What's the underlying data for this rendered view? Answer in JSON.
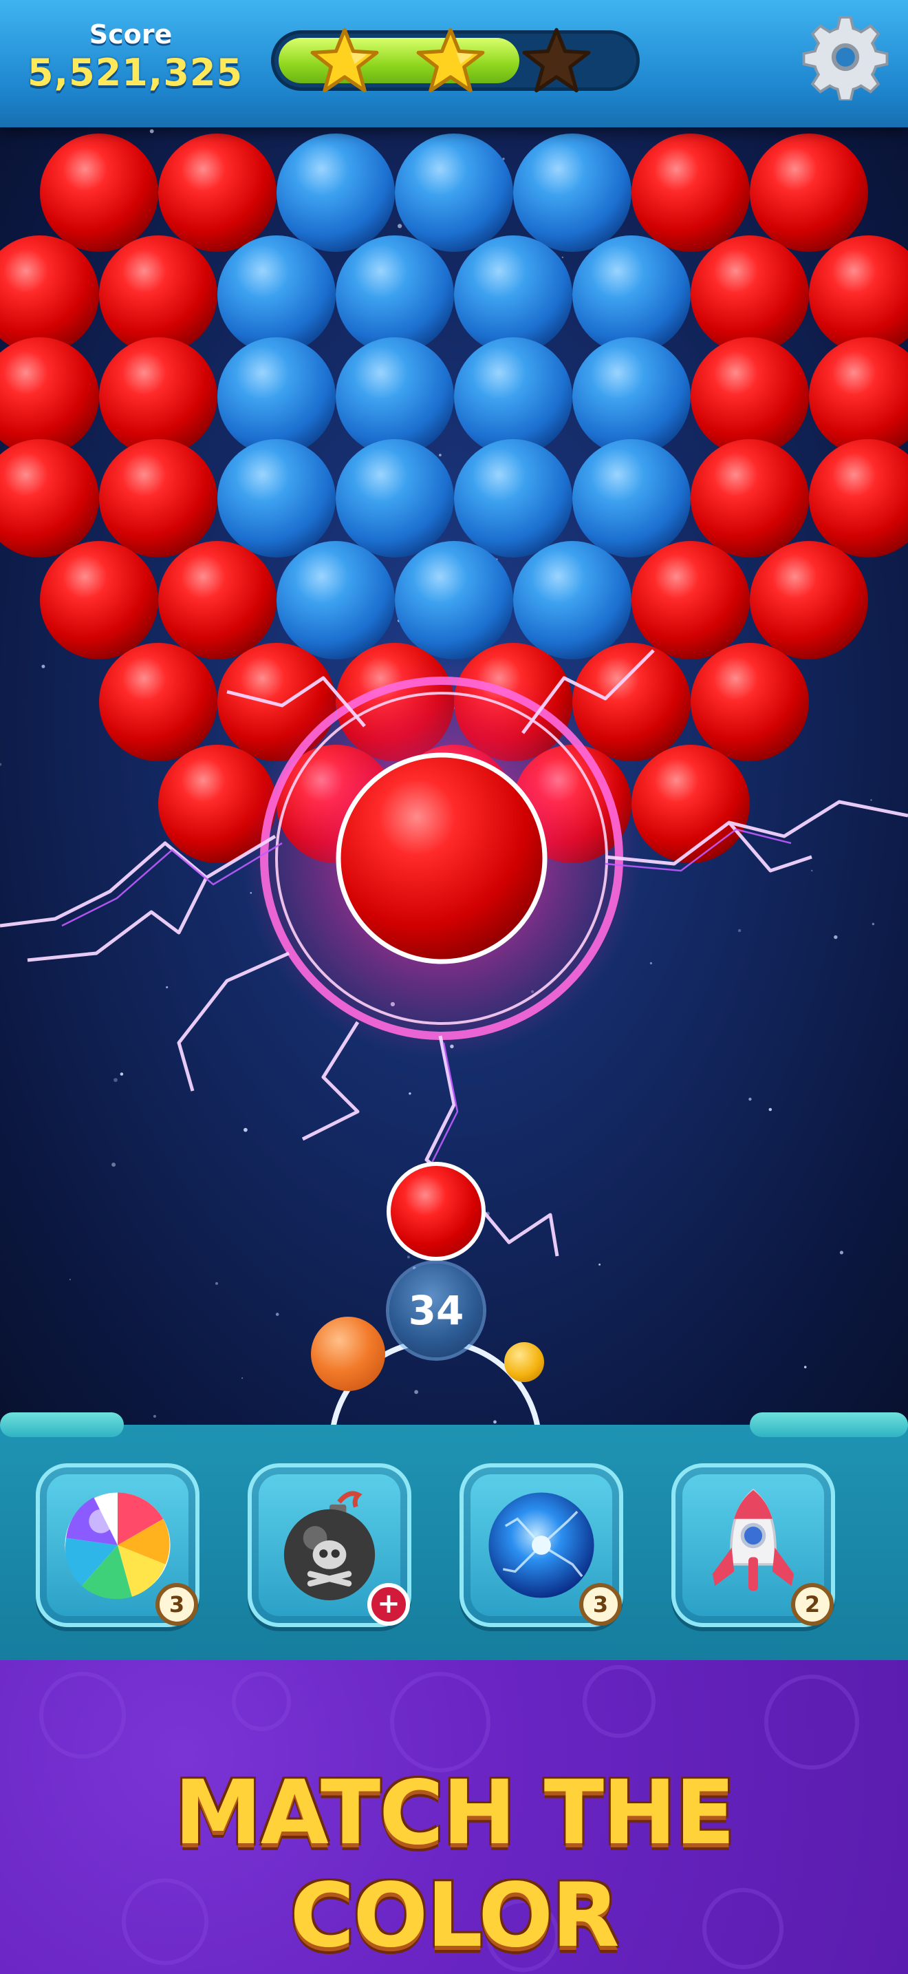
{
  "hud": {
    "score_label": "Score",
    "score_value": "5,521,325",
    "progress_fraction": 0.68,
    "stars": [
      {
        "name": "star-1",
        "earned": true
      },
      {
        "name": "star-2",
        "earned": true
      },
      {
        "name": "star-3",
        "earned": false
      }
    ],
    "settings_icon": "gear-icon"
  },
  "colors": {
    "red_bubble": "#e80f0f",
    "blue_bubble": "#2f8fe0",
    "star_gold": "#ffd21f",
    "lightning": "#ff5cf0",
    "banner_purple": "#6a25c4",
    "banner_text": "#ffd23a"
  },
  "board": {
    "rows": [
      [
        "red",
        "red",
        "blue",
        "blue",
        "blue",
        "red",
        "red"
      ],
      [
        "red",
        "red",
        "blue",
        "blue",
        "blue",
        "blue",
        "red",
        "red"
      ],
      [
        "red",
        "red",
        "blue",
        "blue",
        "blue",
        "blue",
        "red",
        "red"
      ],
      [
        "red",
        "red",
        "blue",
        "blue",
        "blue",
        "blue",
        "red",
        "red"
      ],
      [
        "red",
        "red",
        "blue",
        "blue",
        "blue",
        "red",
        "red"
      ],
      [
        "red",
        "red",
        "red",
        "red",
        "red",
        "red"
      ],
      [
        "red",
        "red",
        "red",
        "red",
        "red"
      ]
    ],
    "effect": "lightning-burst"
  },
  "shooter": {
    "current_color": "red",
    "shots_left": "34",
    "next_color": "orange"
  },
  "boosters": [
    {
      "name": "rainbow-ball-booster",
      "icon": "rainbow-ball-icon",
      "count": "3"
    },
    {
      "name": "bomb-booster",
      "icon": "bomb-icon",
      "count": "+"
    },
    {
      "name": "energy-orb-booster",
      "icon": "energy-orb-icon",
      "count": "3"
    },
    {
      "name": "rocket-booster",
      "icon": "rocket-icon",
      "count": "2"
    }
  ],
  "banner": {
    "text": "MATCH THE COLOR"
  }
}
